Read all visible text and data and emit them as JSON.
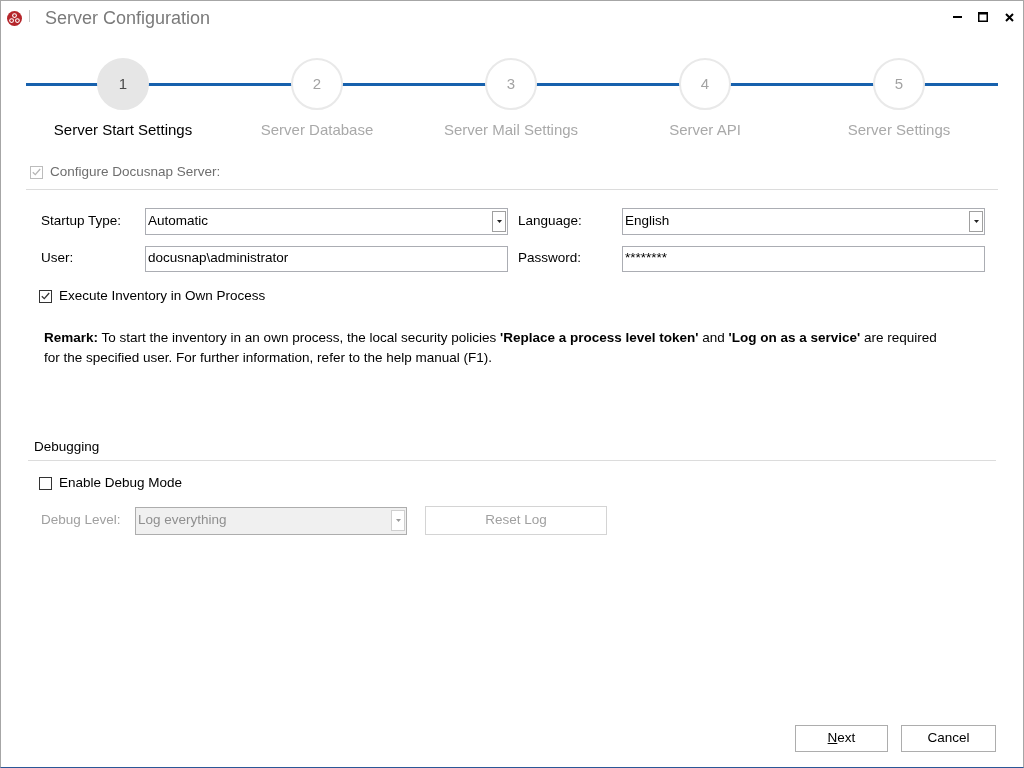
{
  "window": {
    "title": "Server Configuration"
  },
  "steps": [
    {
      "number": "1",
      "label": "Server Start Settings",
      "selected": true
    },
    {
      "number": "2",
      "label": "Server Database",
      "selected": false
    },
    {
      "number": "3",
      "label": "Server Mail Settings",
      "selected": false
    },
    {
      "number": "4",
      "label": "Server API",
      "selected": false
    },
    {
      "number": "5",
      "label": "Server Settings",
      "selected": false
    }
  ],
  "configure_server": {
    "label": "Configure Docusnap Server:",
    "checked": true,
    "disabled": true
  },
  "fields": [
    {
      "kind": "select",
      "label": "Startup Type:",
      "value": "Automatic"
    },
    {
      "kind": "select",
      "label": "Language:",
      "value": "English"
    },
    {
      "kind": "text",
      "label": "User:",
      "value": "docusnap\\administrator"
    },
    {
      "kind": "text",
      "label": "Password:",
      "value": "********"
    }
  ],
  "execute_own_process": {
    "label": "Execute Inventory in Own Process",
    "checked": true
  },
  "remark": "**Remark:** To start the inventory in an own process, the local security policies **'Replace a process level token'** and **'Log on as a service'** are required for the specified user. For further information, refer to the help manual (F1).",
  "debugging": {
    "title": "Debugging",
    "enable_debug_mode": {
      "label": "Enable Debug Mode",
      "checked": false
    },
    "debug_level": {
      "label": "Debug Level:",
      "value": "Log everything",
      "disabled": true
    },
    "reset_log": {
      "label": "Reset Log",
      "disabled": true
    }
  },
  "buttons": [
    {
      "label": "Next",
      "underline_first_letter": true
    },
    {
      "label": "Cancel",
      "underline_first_letter": false
    }
  ]
}
